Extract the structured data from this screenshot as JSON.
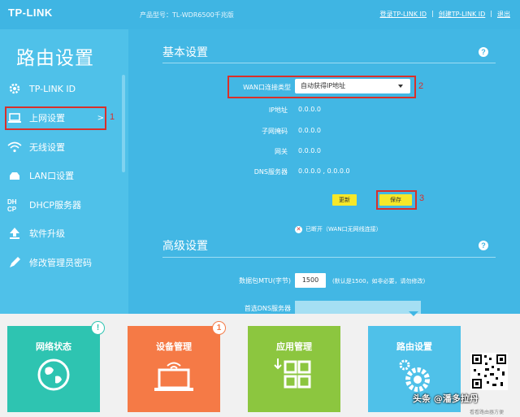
{
  "header": {
    "logo": "TP-LINK",
    "model": "产品型号：TL-WDR6500千兆版",
    "links": [
      "登录TP-LINK ID",
      "|",
      "创建TP-LINK ID",
      "|",
      "退出"
    ]
  },
  "sidebar": {
    "title": "路由设置",
    "items": [
      {
        "label": "TP-LINK ID",
        "icon": "gear-icon"
      },
      {
        "label": "上网设置",
        "icon": "laptop-icon",
        "arrow": ">"
      },
      {
        "label": "无线设置",
        "icon": "wifi-icon"
      },
      {
        "label": "LAN口设置",
        "icon": "lan-icon"
      },
      {
        "label": "DHCP服务器",
        "icon": "dhcp-icon"
      },
      {
        "label": "软件升级",
        "icon": "upload-icon"
      },
      {
        "label": "修改管理员密码",
        "icon": "pencil-icon"
      }
    ]
  },
  "basic": {
    "title": "基本设置",
    "help": "?",
    "wan_label": "WAN口连接类型",
    "wan_value": "自动获得IP地址",
    "rows": [
      {
        "label": "IP地址",
        "value": "0.0.0.0"
      },
      {
        "label": "子网掩码",
        "value": "0.0.0.0"
      },
      {
        "label": "网关",
        "value": "0.0.0.0"
      },
      {
        "label": "DNS服务器",
        "value": "0.0.0.0 , 0.0.0.0"
      }
    ],
    "refresh_label": "更新",
    "save_label": "保存",
    "status_icon": "✕",
    "status": "已断开（WAN口无网线连接）"
  },
  "advanced": {
    "title": "高级设置",
    "help": "?",
    "mtu_label": "数据包MTU(字节)",
    "mtu_value": "1500",
    "mtu_hint": "(默认是1500，如非必要，请勿修改)",
    "dns_label": "首选DNS服务器"
  },
  "annotations": [
    "1",
    "2",
    "3"
  ],
  "tiles": [
    {
      "label": "网络状态",
      "color": "#2ec4b1",
      "badge": "!",
      "icon": "globe-icon"
    },
    {
      "label": "设备管理",
      "color": "#f57a46",
      "badge": "1",
      "icon": "device-icon"
    },
    {
      "label": "应用管理",
      "color": "#8cc63f",
      "icon": "apps-icon"
    },
    {
      "label": "路由设置",
      "color": "#4fc1e9",
      "icon": "settings-icon"
    }
  ],
  "watermark": "头条 @潘多拉丹",
  "watermark_sub": "看看路由器方便"
}
